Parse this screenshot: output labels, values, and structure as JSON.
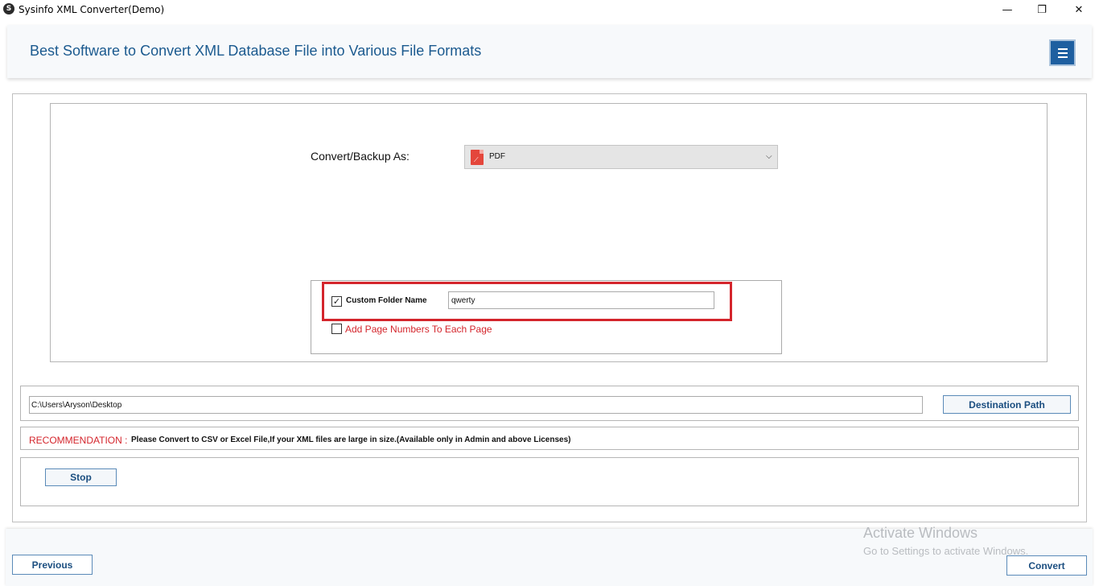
{
  "window": {
    "title": "Sysinfo XML Converter(Demo)",
    "logo_glyph": "S",
    "minimize_glyph": "—",
    "maximize_glyph": "❐",
    "close_glyph": "✕"
  },
  "header": {
    "title": "Best Software to Convert XML Database File into Various File Formats"
  },
  "conversion": {
    "label": "Convert/Backup As:",
    "selected_format": "PDF",
    "format_icon": "pdf-icon"
  },
  "options": {
    "custom_folder": {
      "label": "Custom Folder Name",
      "checked": true,
      "check_glyph": "✓",
      "value": "qwerty"
    },
    "page_numbers": {
      "label": "Add Page Numbers To Each Page",
      "checked": false
    }
  },
  "destination": {
    "path": "C:\\Users\\Aryson\\Desktop",
    "button_label": "Destination Path"
  },
  "recommendation": {
    "label": "RECOMMENDATION :",
    "text": "Please Convert to CSV or Excel File,If your XML files are large in size.(Available only in Admin and above Licenses)"
  },
  "actions": {
    "stop_label": "Stop",
    "previous_label": "Previous",
    "convert_label": "Convert"
  },
  "watermark": {
    "title": "Activate Windows",
    "subtitle": "Go to Settings to activate Windows."
  },
  "colors": {
    "accent": "#1e5fa0",
    "title_text": "#1b5a8f",
    "highlight": "#d4252c",
    "warning_text": "#d4252c"
  }
}
